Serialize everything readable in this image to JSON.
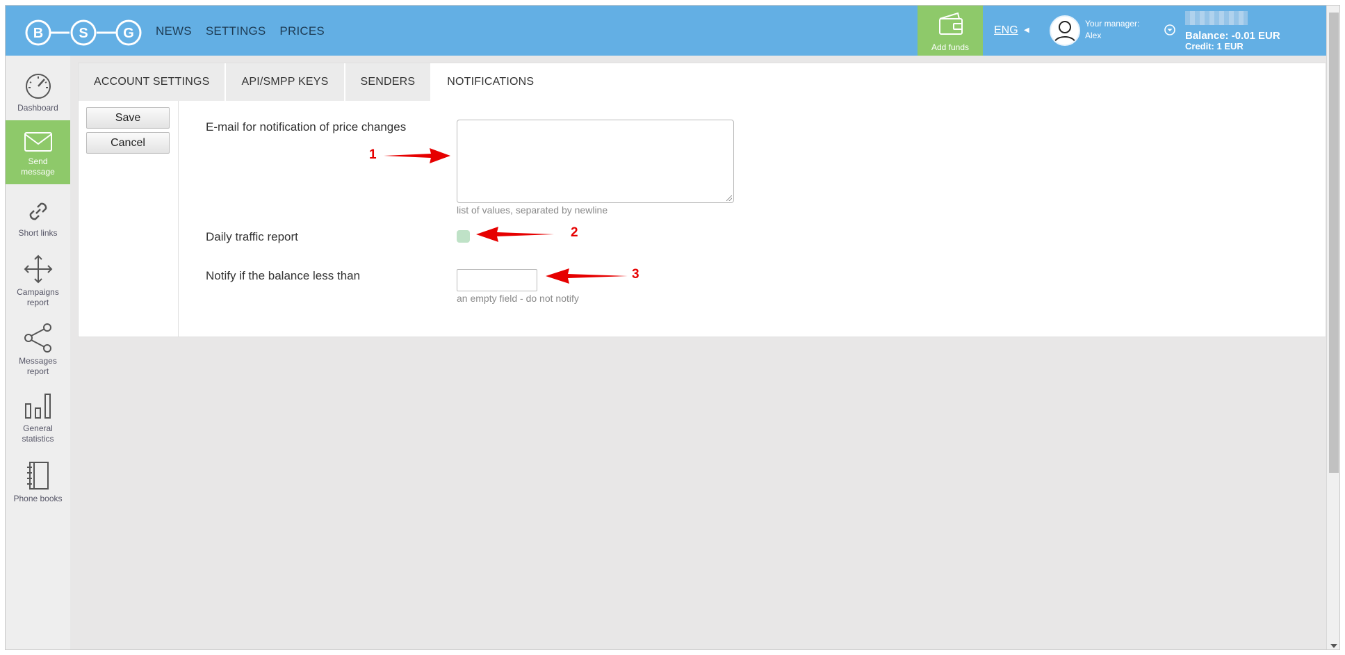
{
  "logo": {
    "letters": [
      "B",
      "S",
      "G"
    ]
  },
  "nav": {
    "items": [
      "NEWS",
      "SETTINGS",
      "PRICES"
    ]
  },
  "header": {
    "add_funds": "Add funds",
    "lang": "ENG",
    "manager_label": "Your manager:",
    "manager_name": "Alex",
    "balance": "Balance: -0.01 EUR",
    "credit": "Credit: 1 EUR"
  },
  "sidebar": {
    "items": [
      {
        "label": "Dashboard",
        "icon": "speedometer-icon"
      },
      {
        "label": "Send message",
        "icon": "envelope-icon"
      },
      {
        "label": "Short links",
        "icon": "link-icon"
      },
      {
        "label": "Campaigns report",
        "icon": "move-arrows-icon"
      },
      {
        "label": "Messages report",
        "icon": "share-icon"
      },
      {
        "label": "General statistics",
        "icon": "bar-chart-icon"
      },
      {
        "label": "Phone books",
        "icon": "notebook-icon"
      }
    ]
  },
  "tabs": [
    {
      "label": "ACCOUNT SETTINGS",
      "active": false
    },
    {
      "label": "API/SMPP KEYS",
      "active": false
    },
    {
      "label": "SENDERS",
      "active": false
    },
    {
      "label": "NOTIFICATIONS",
      "active": true
    }
  ],
  "actions": {
    "save": "Save",
    "cancel": "Cancel"
  },
  "form": {
    "email_label": "E-mail for notification of price changes",
    "email_value": "",
    "email_hint": "list of values, separated by newline",
    "daily_label": "Daily traffic report",
    "daily_checked": false,
    "balance_label": "Notify if the balance less than",
    "balance_value": "",
    "balance_hint": "an empty field - do not notify"
  },
  "annotations": [
    "1",
    "2",
    "3"
  ],
  "colors": {
    "header": "#63afe4",
    "accent_green": "#8ec96a",
    "arrow_red": "#e60000"
  }
}
